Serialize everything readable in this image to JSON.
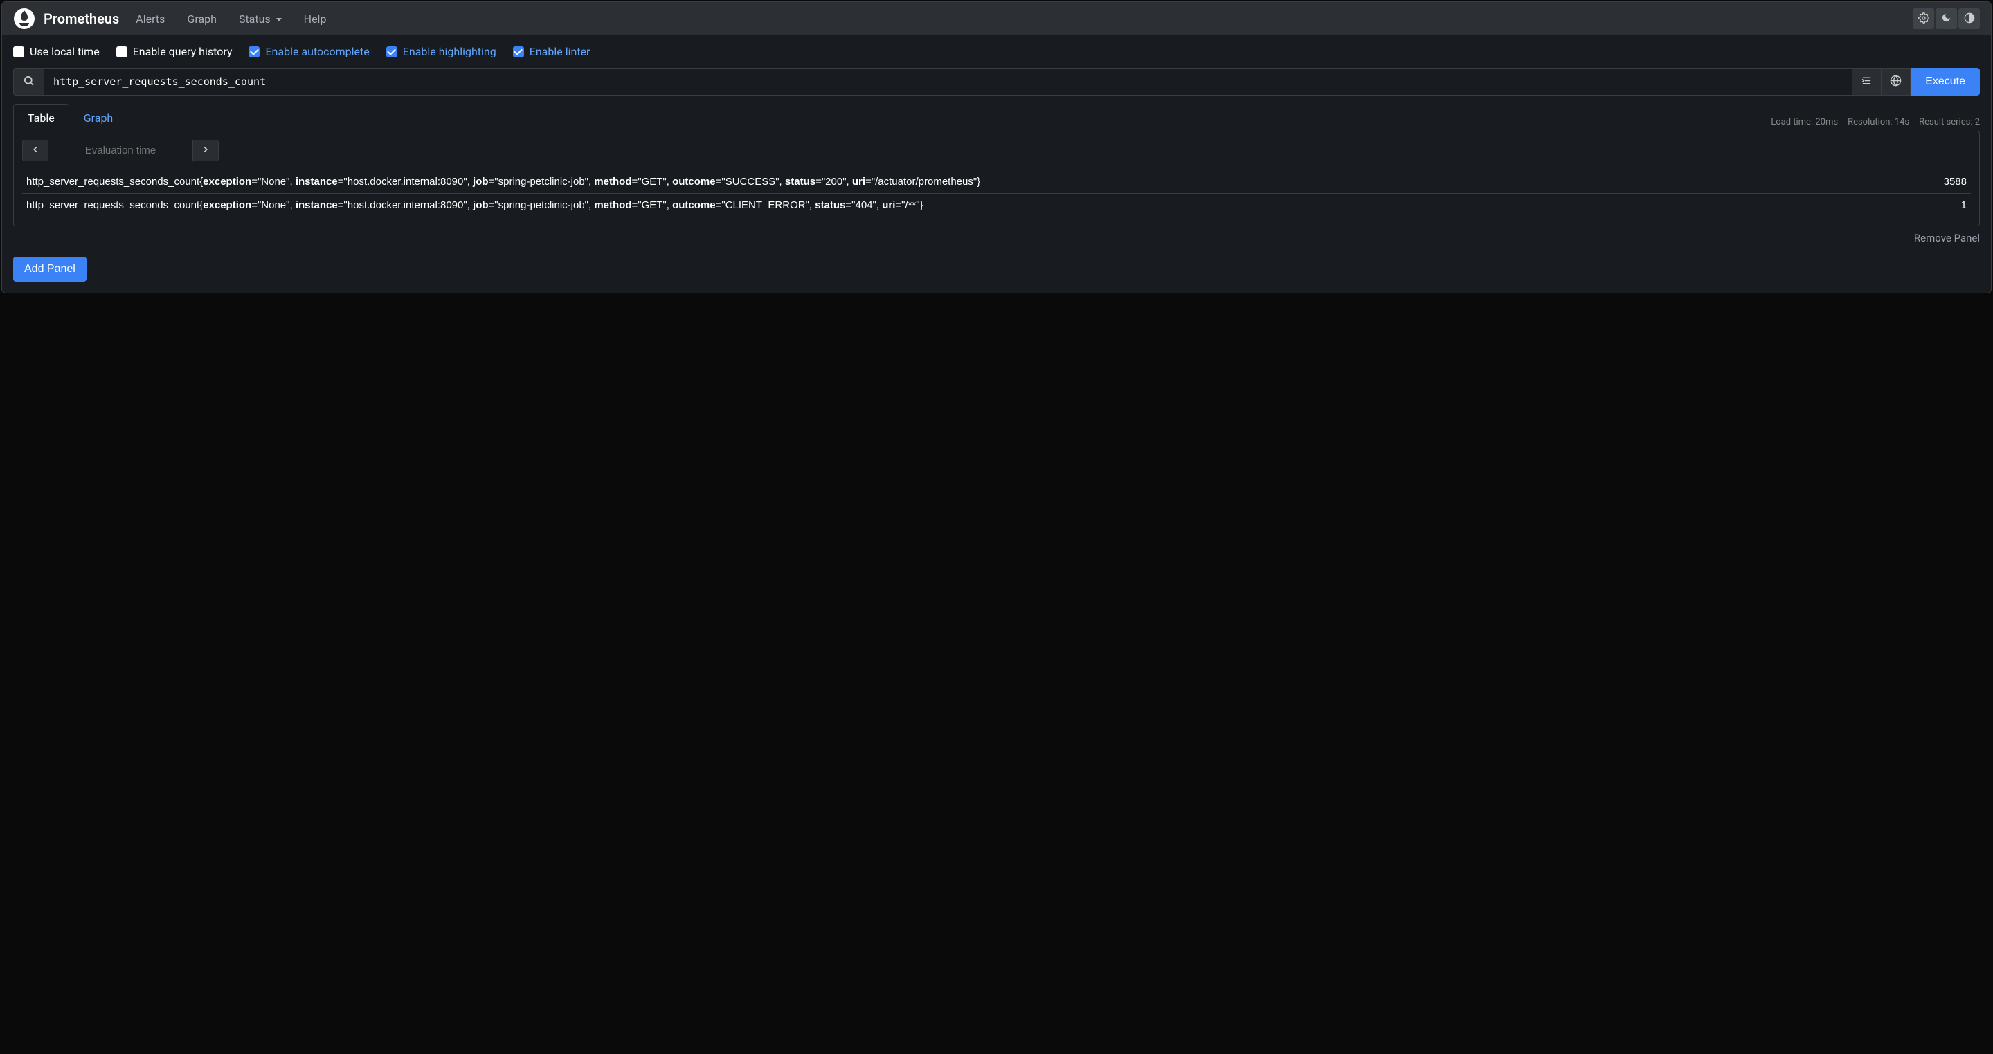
{
  "brand": "Prometheus",
  "nav": {
    "alerts": "Alerts",
    "graph": "Graph",
    "status": "Status",
    "help": "Help"
  },
  "options": {
    "local_time": {
      "label": "Use local time",
      "checked": false
    },
    "query_history": {
      "label": "Enable query history",
      "checked": false
    },
    "autocomplete": {
      "label": "Enable autocomplete",
      "checked": true
    },
    "highlighting": {
      "label": "Enable highlighting",
      "checked": true
    },
    "linter": {
      "label": "Enable linter",
      "checked": true
    }
  },
  "query": "http_server_requests_seconds_count",
  "execute_label": "Execute",
  "tabs": {
    "table": "Table",
    "graph": "Graph"
  },
  "stats": {
    "load_time": "Load time: 20ms",
    "resolution": "Resolution: 14s",
    "result_series": "Result series: 2"
  },
  "eval_time_placeholder": "Evaluation time",
  "results": [
    {
      "metric": "http_server_requests_seconds_count",
      "labels": {
        "exception": "None",
        "instance": "host.docker.internal:8090",
        "job": "spring-petclinic-job",
        "method": "GET",
        "outcome": "SUCCESS",
        "status": "200",
        "uri": "/actuator/prometheus"
      },
      "value": "3588"
    },
    {
      "metric": "http_server_requests_seconds_count",
      "labels": {
        "exception": "None",
        "instance": "host.docker.internal:8090",
        "job": "spring-petclinic-job",
        "method": "GET",
        "outcome": "CLIENT_ERROR",
        "status": "404",
        "uri": "/**"
      },
      "value": "1"
    }
  ],
  "remove_panel": "Remove Panel",
  "add_panel": "Add Panel"
}
